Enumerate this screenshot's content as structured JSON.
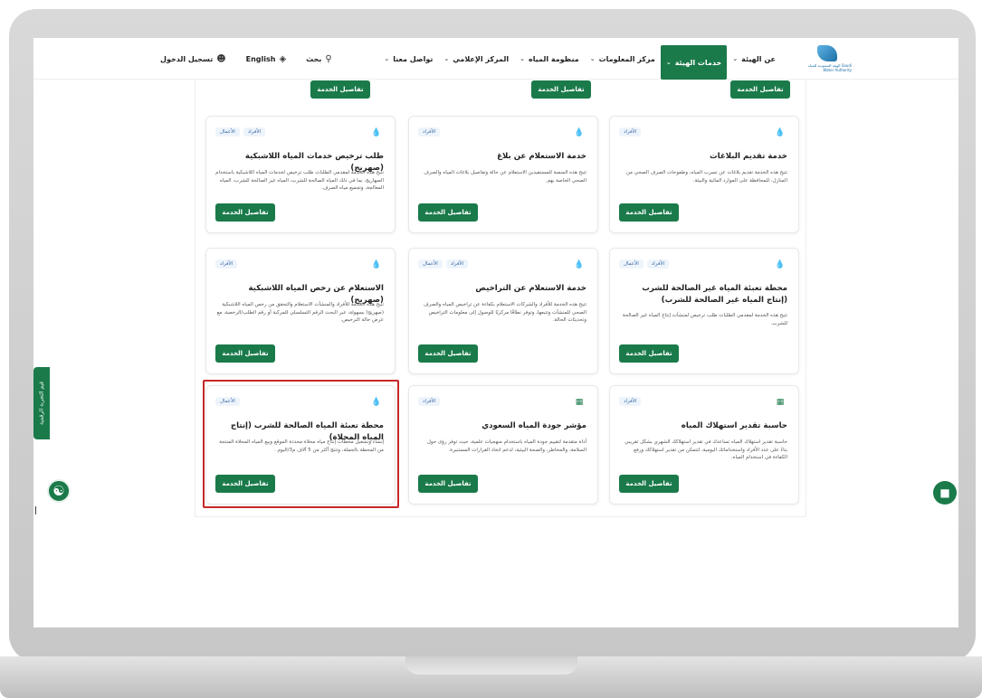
{
  "header": {
    "logo_text": "الهيئة السعودية للمياه\nSaudi Water Authority",
    "nav": [
      {
        "label": "عن الهيئة",
        "active": false
      },
      {
        "label": "خدمات الهيئة",
        "active": true
      },
      {
        "label": "مركز المعلومات",
        "active": false
      },
      {
        "label": "منظومة المياه",
        "active": false
      },
      {
        "label": "المركز الإعلامي",
        "active": false
      },
      {
        "label": "تواصل معنا",
        "active": false
      }
    ],
    "search_label": "بحث",
    "language_label": "English",
    "login_label": "تسجيل الدخول"
  },
  "service_button_label": "تفاصيل الخدمة",
  "cards": [
    {
      "title": "خدمة تقديم البلاغات",
      "tags": [
        "الأفراد"
      ],
      "icon": "water-drop-icon",
      "desc": "تتيح هذه الخدمة تقديم بلاغات عن تسرب المياه، وطفوحات الصرف الصحي من المنازل، للمحافظة على الموارد المائية والبيئة."
    },
    {
      "title": "خدمة الاستعلام عن بلاغ",
      "tags": [
        "الأفراد"
      ],
      "icon": "water-drop-icon",
      "desc": "تتيح هذه المنصة للمستفيدين الاستعلام عن حالة وتفاصيل بلاغات المياه والصرف الصحي الخاصة بهم."
    },
    {
      "title": "طلب ترخيص خدمات المياه اللاشبكية (صهريج)",
      "tags": [
        "الأعمال",
        "الأفراد"
      ],
      "icon": "water-drop-icon",
      "desc": "تتيح هذه الخدمة لمقدمي الطلبات طلب ترخيص لخدمات المياه اللاشبكية باستخدام الصهاريج، بما في ذلك المياه الصالحة للشرب، المياه غير الصالحة للشرب، المياه المعالجة، وتجميع مياه الصرف."
    },
    {
      "title": "محطة تعبئة المياه غير الصالحة للشرب (إنتاج المياه غير الصالحة للشرب)",
      "tags": [
        "الأعمال",
        "الأفراد"
      ],
      "icon": "water-drop-icon",
      "desc": "تتيح هذه الخدمة لمقدمي الطلبات طلب ترخيص لمنشآت إنتاج المياه غير الصالحة للشرب."
    },
    {
      "title": "خدمة الاستعلام عن التراخيص",
      "tags": [
        "الأفراد",
        "الأعمال"
      ],
      "icon": "water-drop-icon",
      "desc": "تتيح هذه الخدمة للأفراد والشركات الاستعلام بكفاءة عن تراخيص المياه والصرف الصحي للمنشآت وتتبعها، وتوفر نطاقًا مركزيًا للوصول إلى معلومات التراخيص وتحديثات الحالة."
    },
    {
      "title": "الاستعلام عن رخص المياه اللاشبكية (صهريج)",
      "tags": [
        "الأفراد"
      ],
      "icon": "water-drop-icon",
      "desc": "تتيح هذه الخدمة للأفراد والمنشآت الاستعلام والتحقق من رخص المياه اللاشبكية (صهريج) بسهولة، عبر البحث الرقم التسلسلي للمركبة أو رقم الطلب/الرخصة، مع عرض حالة الترخيص."
    },
    {
      "title": "حاسبة تقدير استهلاك المياه",
      "tags": [
        "الأفراد"
      ],
      "icon": "calculator-icon",
      "desc": "حاسبة تقدير استهلاك المياه تساعدك في تقدير استهلاكك الشهري بشكل تقريبي بناءً على عدد الأفراد واستخداماتك اليومية، لتتمكن من تقدير استهلاكك ورفع الكفاءة في استخدام المياه."
    },
    {
      "title": "مؤشر جودة المياه السعودي",
      "tags": [
        "الأفراد"
      ],
      "icon": "calculator-icon",
      "desc": "أداة متقدمة لتقييم جودة المياه باستخدام منهجيات علمية، حيث توفر رؤى حول السلامة، والمخاطر، والصحة البيئية، لدعم اتخاذ القرارات المستنيرة."
    },
    {
      "title": "محطة تعبئة المياه الصالحة للشرب (إنتاج المياه المحلاة)",
      "tags": [
        "الأعمال"
      ],
      "icon": "water-drop-icon",
      "desc": "إنشاء وتشغيل محطات إنتاج مياه محلاة محددة الموقع وبيع المياه المحلاة المنتجة من المحطة بالجملة، وتنتج أكثر من 5 آلاف م3/اليوم ."
    }
  ],
  "side_tab_label": "قيم التجربة الرقمية",
  "accessibility_icon": "accessibility-icon",
  "chat_icon": "chat-icon",
  "colors": {
    "brand_green": "#1a7a4a",
    "highlight_red": "#c62828",
    "tag_blue": "#3a6aa8"
  }
}
